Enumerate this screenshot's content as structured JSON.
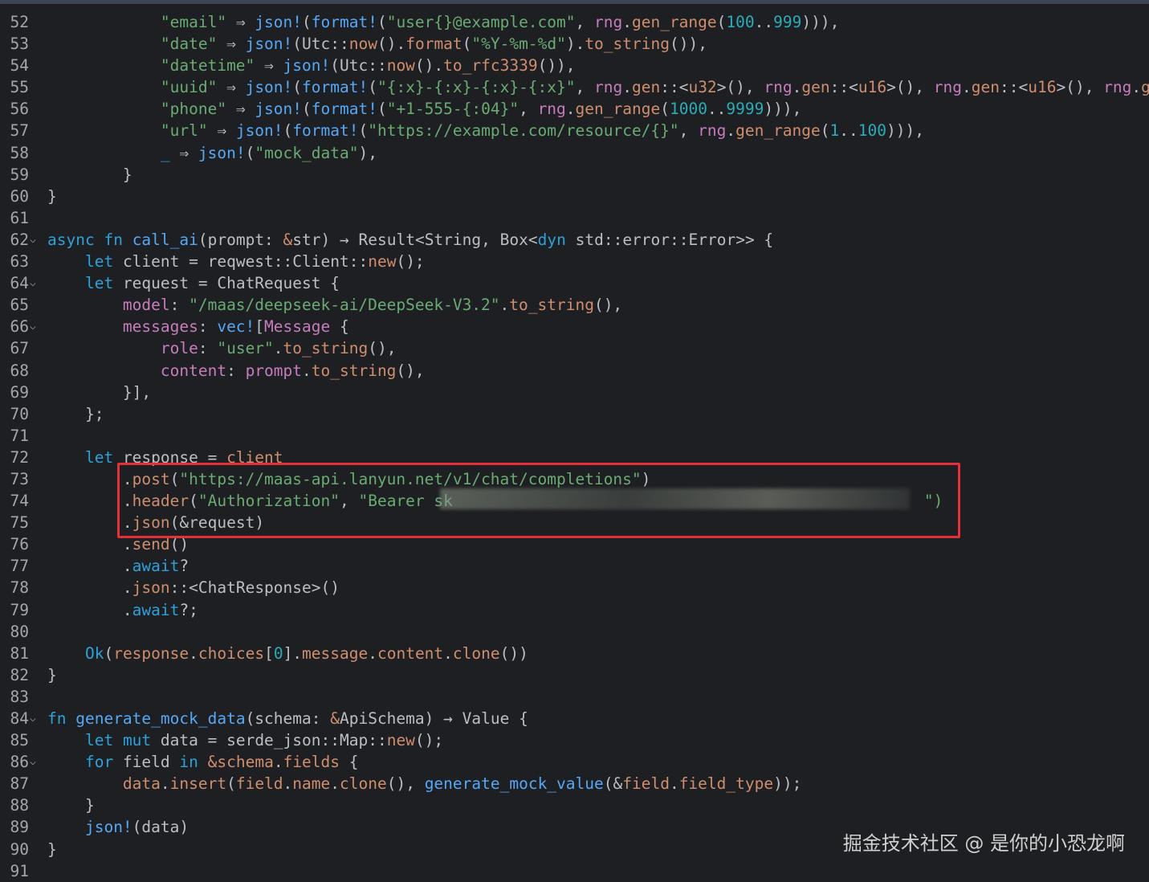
{
  "watermark": "掘金技术社区 @ 是你的小恐龙啊",
  "colors": {
    "background": "#1e1f22",
    "highlight_border": "#e5303a"
  },
  "lines": [
    {
      "n": "52",
      "segments": [
        [
          "            ",
          "t"
        ],
        [
          "\"email\"",
          "s"
        ],
        [
          " ⇒ ",
          "t"
        ],
        [
          "json!",
          "f"
        ],
        [
          "(",
          "t"
        ],
        [
          "format!",
          "f"
        ],
        [
          "(",
          "t"
        ],
        [
          "\"user{}@example.com\"",
          "s"
        ],
        [
          ", ",
          "t"
        ],
        [
          "rng",
          "o"
        ],
        [
          ".",
          "t"
        ],
        [
          "gen_range",
          "k"
        ],
        [
          "(",
          "t"
        ],
        [
          "100",
          "n"
        ],
        [
          "..",
          "t"
        ],
        [
          "999",
          "n"
        ],
        [
          "))),",
          "t"
        ]
      ]
    },
    {
      "n": "53",
      "segments": [
        [
          "            ",
          "t"
        ],
        [
          "\"date\"",
          "s"
        ],
        [
          " ⇒ ",
          "t"
        ],
        [
          "json!",
          "f"
        ],
        [
          "(",
          "t"
        ],
        [
          "Utc",
          "t"
        ],
        [
          "::",
          "t"
        ],
        [
          "now",
          "k"
        ],
        [
          "().",
          "t"
        ],
        [
          "format",
          "k"
        ],
        [
          "(",
          "t"
        ],
        [
          "\"%Y-%m-%d\"",
          "s"
        ],
        [
          ").",
          "t"
        ],
        [
          "to_string",
          "k"
        ],
        [
          "()),",
          "t"
        ]
      ]
    },
    {
      "n": "54",
      "segments": [
        [
          "            ",
          "t"
        ],
        [
          "\"datetime\"",
          "s"
        ],
        [
          " ⇒ ",
          "t"
        ],
        [
          "json!",
          "f"
        ],
        [
          "(",
          "t"
        ],
        [
          "Utc",
          "t"
        ],
        [
          "::",
          "t"
        ],
        [
          "now",
          "k"
        ],
        [
          "().",
          "t"
        ],
        [
          "to_rfc3339",
          "k"
        ],
        [
          "()),",
          "t"
        ]
      ]
    },
    {
      "n": "55",
      "segments": [
        [
          "            ",
          "t"
        ],
        [
          "\"uuid\"",
          "s"
        ],
        [
          " ⇒ ",
          "t"
        ],
        [
          "json!",
          "f"
        ],
        [
          "(",
          "t"
        ],
        [
          "format!",
          "f"
        ],
        [
          "(",
          "t"
        ],
        [
          "\"{:x}-{:x}-{:x}-{:x}\"",
          "s"
        ],
        [
          ", ",
          "t"
        ],
        [
          "rng",
          "o"
        ],
        [
          ".",
          "t"
        ],
        [
          "gen",
          "k"
        ],
        [
          "::<",
          "t"
        ],
        [
          "u32",
          "k"
        ],
        [
          ">(), ",
          "t"
        ],
        [
          "rng",
          "o"
        ],
        [
          ".",
          "t"
        ],
        [
          "gen",
          "k"
        ],
        [
          "::<",
          "t"
        ],
        [
          "u16",
          "k"
        ],
        [
          ">(), ",
          "t"
        ],
        [
          "rng",
          "o"
        ],
        [
          ".",
          "t"
        ],
        [
          "gen",
          "k"
        ],
        [
          "::<",
          "t"
        ],
        [
          "u16",
          "k"
        ],
        [
          ">(), ",
          "t"
        ],
        [
          "rng",
          "o"
        ],
        [
          ".",
          "t"
        ],
        [
          "gen",
          "k"
        ],
        [
          "::",
          "t"
        ]
      ]
    },
    {
      "n": "56",
      "segments": [
        [
          "            ",
          "t"
        ],
        [
          "\"phone\"",
          "s"
        ],
        [
          " ⇒ ",
          "t"
        ],
        [
          "json!",
          "f"
        ],
        [
          "(",
          "t"
        ],
        [
          "format!",
          "f"
        ],
        [
          "(",
          "t"
        ],
        [
          "\"+1-555-{:04}\"",
          "s"
        ],
        [
          ", ",
          "t"
        ],
        [
          "rng",
          "o"
        ],
        [
          ".",
          "t"
        ],
        [
          "gen_range",
          "k"
        ],
        [
          "(",
          "t"
        ],
        [
          "1000",
          "n"
        ],
        [
          "..",
          "t"
        ],
        [
          "9999",
          "n"
        ],
        [
          "))),",
          "t"
        ]
      ]
    },
    {
      "n": "57",
      "segments": [
        [
          "            ",
          "t"
        ],
        [
          "\"url\"",
          "s"
        ],
        [
          " ⇒ ",
          "t"
        ],
        [
          "json!",
          "f"
        ],
        [
          "(",
          "t"
        ],
        [
          "format!",
          "f"
        ],
        [
          "(",
          "t"
        ],
        [
          "\"https://example.com/resource/{}\"",
          "s"
        ],
        [
          ", ",
          "t"
        ],
        [
          "rng",
          "o"
        ],
        [
          ".",
          "t"
        ],
        [
          "gen_range",
          "k"
        ],
        [
          "(",
          "t"
        ],
        [
          "1",
          "n"
        ],
        [
          "..",
          "t"
        ],
        [
          "100",
          "n"
        ],
        [
          "))),",
          "t"
        ]
      ]
    },
    {
      "n": "58",
      "segments": [
        [
          "            ",
          "t"
        ],
        [
          "_",
          "kb"
        ],
        [
          " ⇒ ",
          "t"
        ],
        [
          "json!",
          "f"
        ],
        [
          "(",
          "t"
        ],
        [
          "\"mock_data\"",
          "s"
        ],
        [
          "),",
          "t"
        ]
      ]
    },
    {
      "n": "59",
      "segments": [
        [
          "        }",
          "t"
        ]
      ]
    },
    {
      "n": "60",
      "segments": [
        [
          "}",
          "t"
        ]
      ]
    },
    {
      "n": "61",
      "segments": []
    },
    {
      "n": "62",
      "fold": true,
      "segments": [
        [
          "async ",
          "kb"
        ],
        [
          "fn ",
          "kb"
        ],
        [
          "call_ai",
          "f"
        ],
        [
          "(prompt: ",
          "t"
        ],
        [
          "&",
          "k"
        ],
        [
          "str",
          "t"
        ],
        [
          ") → ",
          "t"
        ],
        [
          "Result",
          "t"
        ],
        [
          "<",
          "t"
        ],
        [
          "String",
          "t"
        ],
        [
          ", ",
          "t"
        ],
        [
          "Box",
          "t"
        ],
        [
          "<",
          "t"
        ],
        [
          "dyn ",
          "kb"
        ],
        [
          "std",
          "t"
        ],
        [
          "::",
          "t"
        ],
        [
          "error",
          "t"
        ],
        [
          "::",
          "t"
        ],
        [
          "Error",
          "t"
        ],
        [
          ">> {",
          "t"
        ]
      ]
    },
    {
      "n": "63",
      "segments": [
        [
          "    ",
          "t"
        ],
        [
          "let ",
          "kb"
        ],
        [
          "client = ",
          "t"
        ],
        [
          "reqwest",
          "t"
        ],
        [
          "::",
          "t"
        ],
        [
          "Client",
          "t"
        ],
        [
          "::",
          "t"
        ],
        [
          "new",
          "k"
        ],
        [
          "();",
          "t"
        ]
      ]
    },
    {
      "n": "64",
      "fold": true,
      "segments": [
        [
          "    ",
          "t"
        ],
        [
          "let ",
          "kb"
        ],
        [
          "request = ",
          "t"
        ],
        [
          "ChatRequest",
          "t"
        ],
        [
          " {",
          "t"
        ]
      ]
    },
    {
      "n": "65",
      "segments": [
        [
          "        ",
          "t"
        ],
        [
          "model",
          "fld"
        ],
        [
          ": ",
          "t"
        ],
        [
          "\"/maas/deepseek-ai/DeepSeek-V3.2\"",
          "s"
        ],
        [
          ".",
          "t"
        ],
        [
          "to_string",
          "k"
        ],
        [
          "(),",
          "t"
        ]
      ]
    },
    {
      "n": "66",
      "fold": true,
      "segments": [
        [
          "        ",
          "t"
        ],
        [
          "messages",
          "fld"
        ],
        [
          ": ",
          "t"
        ],
        [
          "vec!",
          "f"
        ],
        [
          "[",
          "t"
        ],
        [
          "Message",
          "fld"
        ],
        [
          " {",
          "t"
        ]
      ]
    },
    {
      "n": "67",
      "segments": [
        [
          "            ",
          "t"
        ],
        [
          "role",
          "fld"
        ],
        [
          ": ",
          "t"
        ],
        [
          "\"user\"",
          "s"
        ],
        [
          ".",
          "t"
        ],
        [
          "to_string",
          "k"
        ],
        [
          "(),",
          "t"
        ]
      ]
    },
    {
      "n": "68",
      "segments": [
        [
          "            ",
          "t"
        ],
        [
          "content",
          "fld"
        ],
        [
          ": ",
          "t"
        ],
        [
          "prompt",
          "fld"
        ],
        [
          ".",
          "t"
        ],
        [
          "to_string",
          "k"
        ],
        [
          "(),",
          "t"
        ]
      ]
    },
    {
      "n": "69",
      "segments": [
        [
          "        }],",
          "t"
        ]
      ]
    },
    {
      "n": "70",
      "segments": [
        [
          "    };",
          "t"
        ]
      ]
    },
    {
      "n": "71",
      "segments": []
    },
    {
      "n": "72",
      "segments": [
        [
          "    ",
          "t"
        ],
        [
          "let ",
          "kb"
        ],
        [
          "response = ",
          "t"
        ],
        [
          "client",
          "k"
        ]
      ]
    },
    {
      "n": "73",
      "segments": [
        [
          "        .",
          "t"
        ],
        [
          "post",
          "k"
        ],
        [
          "(",
          "t"
        ],
        [
          "\"https://maas-api.lanyun.net/v1/chat/completions\"",
          "s"
        ],
        [
          ")",
          "t"
        ]
      ]
    },
    {
      "n": "74",
      "segments": [
        [
          "        .",
          "t"
        ],
        [
          "header",
          "k"
        ],
        [
          "(",
          "t"
        ],
        [
          "\"Authorization\"",
          "s"
        ],
        [
          ", ",
          "t"
        ],
        [
          "\"Bearer sk",
          "s"
        ],
        [
          "                                                  ",
          "t"
        ],
        [
          "\")",
          "s"
        ]
      ]
    },
    {
      "n": "75",
      "segments": [
        [
          "        .",
          "t"
        ],
        [
          "json",
          "k"
        ],
        [
          "(&",
          "t"
        ],
        [
          "request",
          "t"
        ],
        [
          ")",
          "t"
        ]
      ]
    },
    {
      "n": "76",
      "segments": [
        [
          "        .",
          "t"
        ],
        [
          "send",
          "k"
        ],
        [
          "()",
          "t"
        ]
      ]
    },
    {
      "n": "77",
      "segments": [
        [
          "        .",
          "t"
        ],
        [
          "await",
          "kb"
        ],
        [
          "?",
          "t"
        ]
      ]
    },
    {
      "n": "78",
      "segments": [
        [
          "        .",
          "t"
        ],
        [
          "json",
          "k"
        ],
        [
          "::<",
          "t"
        ],
        [
          "ChatResponse",
          "t"
        ],
        [
          ">()",
          "t"
        ]
      ]
    },
    {
      "n": "79",
      "segments": [
        [
          "        .",
          "t"
        ],
        [
          "await",
          "kb"
        ],
        [
          "?;",
          "t"
        ]
      ]
    },
    {
      "n": "80",
      "segments": []
    },
    {
      "n": "81",
      "segments": [
        [
          "    ",
          "t"
        ],
        [
          "Ok",
          "kb"
        ],
        [
          "(",
          "t"
        ],
        [
          "response",
          "k"
        ],
        [
          ".",
          "t"
        ],
        [
          "choices",
          "k"
        ],
        [
          "[",
          "t"
        ],
        [
          "0",
          "n"
        ],
        [
          "].",
          "t"
        ],
        [
          "message",
          "k"
        ],
        [
          ".",
          "t"
        ],
        [
          "content",
          "k"
        ],
        [
          ".",
          "t"
        ],
        [
          "clone",
          "k"
        ],
        [
          "())",
          "t"
        ]
      ]
    },
    {
      "n": "82",
      "segments": [
        [
          "}",
          "t"
        ]
      ]
    },
    {
      "n": "83",
      "segments": []
    },
    {
      "n": "84",
      "fold": true,
      "segments": [
        [
          "fn ",
          "kb"
        ],
        [
          "generate_mock_data",
          "f"
        ],
        [
          "(schema: ",
          "t"
        ],
        [
          "&",
          "k"
        ],
        [
          "ApiSchema",
          "t"
        ],
        [
          ") → ",
          "t"
        ],
        [
          "Value",
          "t"
        ],
        [
          " {",
          "t"
        ]
      ]
    },
    {
      "n": "85",
      "segments": [
        [
          "    ",
          "t"
        ],
        [
          "let ",
          "kb"
        ],
        [
          "mut ",
          "kb"
        ],
        [
          "data = ",
          "t"
        ],
        [
          "serde_json",
          "t"
        ],
        [
          "::",
          "t"
        ],
        [
          "Map",
          "t"
        ],
        [
          "::",
          "t"
        ],
        [
          "new",
          "k"
        ],
        [
          "();",
          "t"
        ]
      ]
    },
    {
      "n": "86",
      "fold": true,
      "segments": [
        [
          "    ",
          "t"
        ],
        [
          "for ",
          "kb"
        ],
        [
          "field ",
          "t"
        ],
        [
          "in ",
          "kb"
        ],
        [
          "&",
          "k"
        ],
        [
          "schema",
          "k"
        ],
        [
          ".",
          "t"
        ],
        [
          "fields",
          "k"
        ],
        [
          " {",
          "t"
        ]
      ]
    },
    {
      "n": "87",
      "segments": [
        [
          "        ",
          "t"
        ],
        [
          "data",
          "k"
        ],
        [
          ".",
          "t"
        ],
        [
          "insert",
          "k"
        ],
        [
          "(",
          "t"
        ],
        [
          "field",
          "k"
        ],
        [
          ".",
          "t"
        ],
        [
          "name",
          "k"
        ],
        [
          ".",
          "t"
        ],
        [
          "clone",
          "k"
        ],
        [
          "(), ",
          "t"
        ],
        [
          "generate_mock_value",
          "f"
        ],
        [
          "(&",
          "t"
        ],
        [
          "field",
          "k"
        ],
        [
          ".",
          "t"
        ],
        [
          "field_type",
          "k"
        ],
        [
          "));",
          "t"
        ]
      ]
    },
    {
      "n": "88",
      "segments": [
        [
          "    }",
          "t"
        ]
      ]
    },
    {
      "n": "89",
      "segments": [
        [
          "    ",
          "t"
        ],
        [
          "json!",
          "f"
        ],
        [
          "(data)",
          "t"
        ]
      ]
    },
    {
      "n": "90",
      "segments": [
        [
          "}",
          "t"
        ]
      ]
    },
    {
      "n": "91",
      "segments": []
    }
  ]
}
